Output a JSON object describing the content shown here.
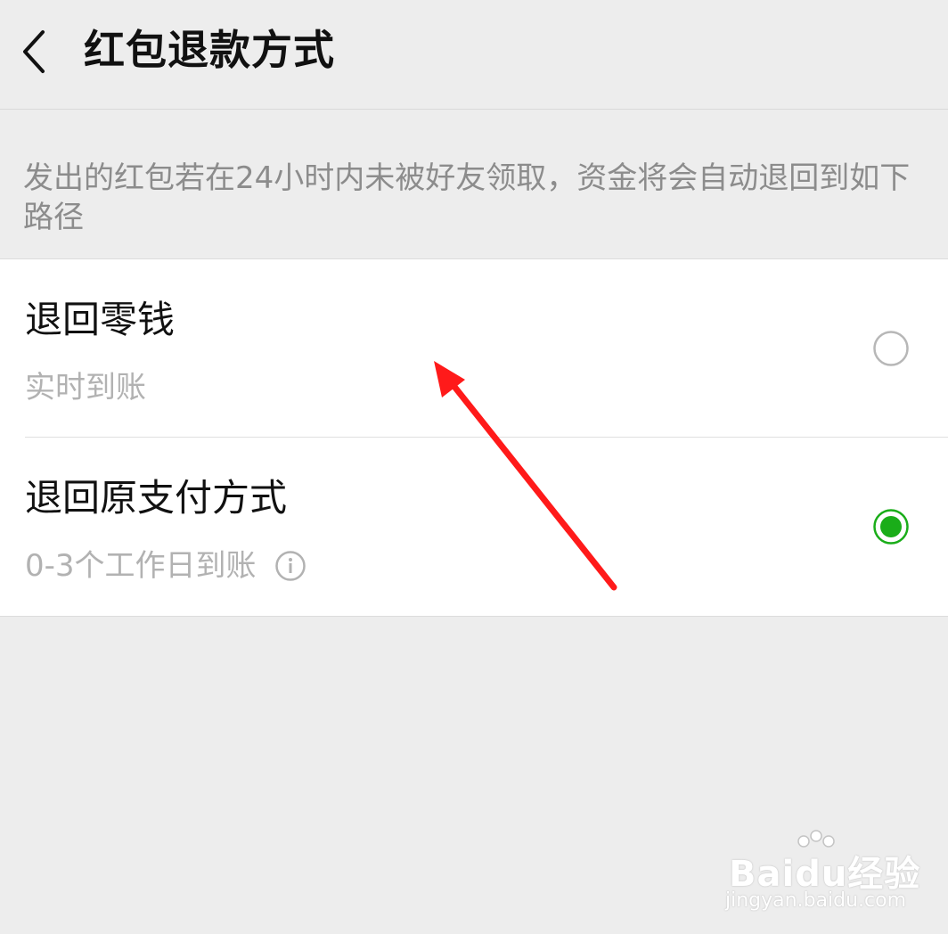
{
  "header": {
    "title": "红包退款方式",
    "back_icon": "chevron-left-icon"
  },
  "description": "发出的红包若在24小时内未被好友领取，资金将会自动退回到如下路径",
  "options": [
    {
      "title": "退回零钱",
      "subtitle": "实时到账",
      "selected": false
    },
    {
      "title": "退回原支付方式",
      "subtitle": "0-3个工作日到账",
      "selected": true,
      "info_icon": "info-icon"
    }
  ],
  "colors": {
    "background": "#ededed",
    "card": "#ffffff",
    "selected_green": "#1aad19",
    "annotation_arrow": "#ff1a1a"
  },
  "watermark": {
    "text": "Baidu经验",
    "url": "jingyan.baidu.com"
  }
}
